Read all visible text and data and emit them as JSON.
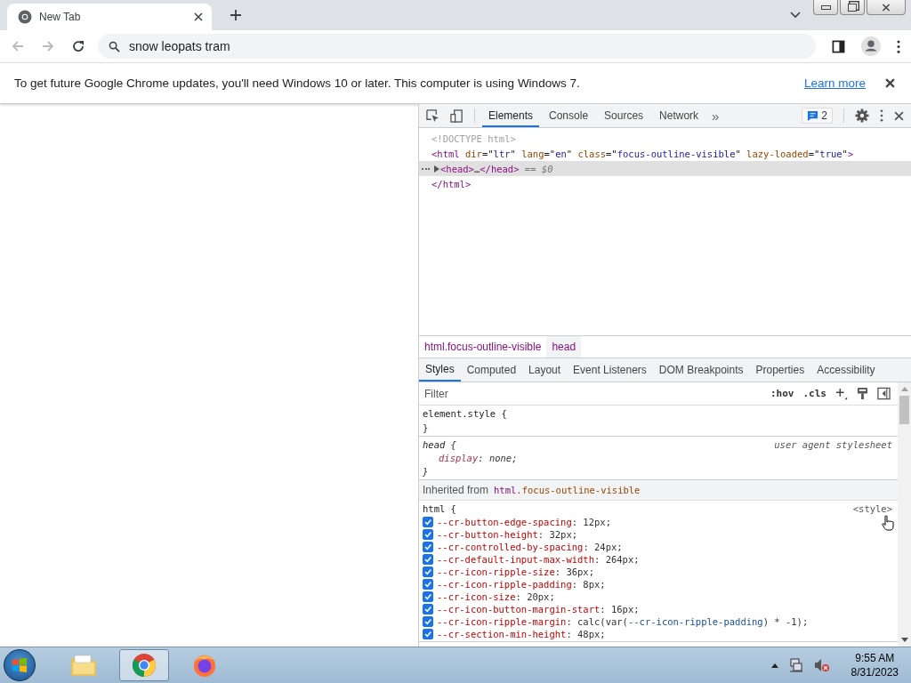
{
  "browser": {
    "tab": {
      "title": "New Tab",
      "selected": true
    },
    "omnibox": {
      "value": "snow leopats tram"
    }
  },
  "infobar": {
    "message": "To get future Google Chrome updates, you'll need Windows 10 or later. This computer is using Windows 7.",
    "link": "Learn more"
  },
  "devtools": {
    "tabs": [
      {
        "label": "Elements",
        "selected": true
      },
      {
        "label": "Console",
        "selected": false
      },
      {
        "label": "Sources",
        "selected": false
      },
      {
        "label": "Network",
        "selected": false
      }
    ],
    "more_tabs": "»",
    "issues_count": "2",
    "dom_lines": [
      {
        "selected": false,
        "expandable": false,
        "tokens": [
          {
            "kind": "comment",
            "text": "<!DOCTYPE html>"
          }
        ]
      },
      {
        "selected": false,
        "expandable": false,
        "tokens": [
          {
            "kind": "tag",
            "text": "<html"
          },
          {
            "kind": "attr",
            "text": " dir"
          },
          {
            "kind": "punct",
            "text": "=\""
          },
          {
            "kind": "value",
            "text": "ltr"
          },
          {
            "kind": "punct",
            "text": "\""
          },
          {
            "kind": "attr",
            "text": " lang"
          },
          {
            "kind": "punct",
            "text": "=\""
          },
          {
            "kind": "value",
            "text": "en"
          },
          {
            "kind": "punct",
            "text": "\""
          },
          {
            "kind": "attr",
            "text": " class"
          },
          {
            "kind": "punct",
            "text": "=\""
          },
          {
            "kind": "value",
            "text": "focus-outline-visible"
          },
          {
            "kind": "punct",
            "text": "\""
          },
          {
            "kind": "attr",
            "text": " lazy-loaded"
          },
          {
            "kind": "punct",
            "text": "=\""
          },
          {
            "kind": "value",
            "text": "true"
          },
          {
            "kind": "punct",
            "text": "\""
          },
          {
            "kind": "tag",
            "text": ">"
          }
        ]
      },
      {
        "selected": true,
        "expandable": true,
        "tokens": [
          {
            "kind": "tag",
            "text": "<head>"
          },
          {
            "kind": "punct",
            "text": "…"
          },
          {
            "kind": "tag",
            "text": "</head>"
          },
          {
            "kind": "ref",
            "text": " == $0"
          }
        ]
      },
      {
        "selected": false,
        "expandable": false,
        "tokens": [
          {
            "kind": "tag",
            "text": "</html>"
          }
        ]
      }
    ],
    "breadcrumbs": [
      {
        "label": "html.focus-outline-visible",
        "selected": false
      },
      {
        "label": "head",
        "selected": true
      }
    ],
    "styles_tabs": [
      {
        "label": "Styles",
        "selected": true
      },
      {
        "label": "Computed",
        "selected": false
      },
      {
        "label": "Layout",
        "selected": false
      },
      {
        "label": "Event Listeners",
        "selected": false
      },
      {
        "label": "DOM Breakpoints",
        "selected": false
      },
      {
        "label": "Properties",
        "selected": false
      },
      {
        "label": "Accessibility",
        "selected": false
      }
    ],
    "filter": {
      "placeholder": "Filter"
    },
    "hov": ":hov",
    "cls": ".cls",
    "rules": [
      {
        "kind": "rule",
        "selector": "element.style {",
        "italic": false,
        "close": "}"
      },
      {
        "kind": "rule",
        "selector": "head {",
        "italic": true,
        "source": "user agent stylesheet",
        "close": "}",
        "declarations": [
          {
            "checkbox": false,
            "name": "display",
            "value": ": none;"
          }
        ]
      },
      {
        "kind": "inherited",
        "label": "Inherited from",
        "selector": "html",
        "selector_class": ".focus-outline-visible"
      },
      {
        "kind": "rule",
        "selector": "html {",
        "italic": false,
        "source": "<style>",
        "declarations": [
          {
            "checkbox": true,
            "checked": true,
            "name": "--cr-button-edge-spacing",
            "value": ": 12px;"
          },
          {
            "checkbox": true,
            "checked": true,
            "name": "--cr-button-height",
            "value": ": 32px;"
          },
          {
            "checkbox": true,
            "checked": true,
            "name": "--cr-controlled-by-spacing",
            "value": ": 24px;"
          },
          {
            "checkbox": true,
            "checked": true,
            "name": "--cr-default-input-max-width",
            "value": ": 264px;"
          },
          {
            "checkbox": true,
            "checked": true,
            "name": "--cr-icon-ripple-size",
            "value": ": 36px;"
          },
          {
            "checkbox": true,
            "checked": true,
            "name": "--cr-icon-ripple-padding",
            "value": ": 8px;"
          },
          {
            "checkbox": true,
            "checked": true,
            "name": "--cr-icon-size",
            "value": ": 20px;"
          },
          {
            "checkbox": true,
            "checked": true,
            "name": "--cr-icon-button-margin-start",
            "value": ": 16px;"
          },
          {
            "checkbox": true,
            "checked": true,
            "name": "--cr-icon-ripple-margin",
            "value": ": calc(var(",
            "value_var": "--cr-icon-ripple-padding",
            "value_end": ") * -1);"
          },
          {
            "checkbox": true,
            "checked": true,
            "name": "--cr-section-min-height",
            "value": ": 48px;"
          }
        ]
      }
    ]
  },
  "taskbar": {
    "apps": [
      {
        "kind": "folder",
        "selected": false
      },
      {
        "kind": "chrome",
        "selected": true
      },
      {
        "kind": "firefox",
        "selected": false
      }
    ],
    "time": "9:55 AM",
    "date": "8/31/2023"
  }
}
